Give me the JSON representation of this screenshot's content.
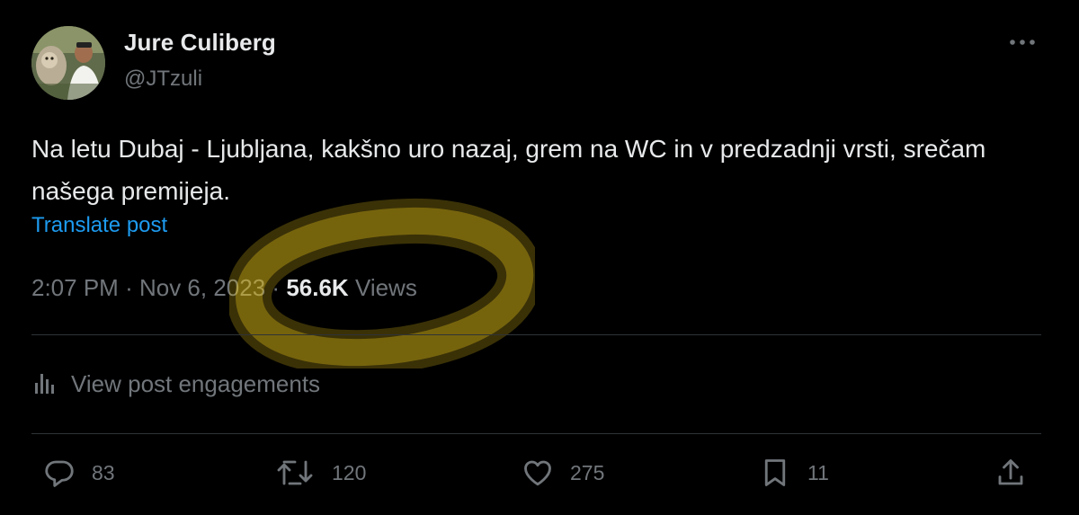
{
  "author": {
    "name": "Jure Culiberg",
    "handle": "@JTzuli"
  },
  "post": {
    "text": "Na letu Dubaj - Ljubljana, kakšno uro nazaj, grem na WC in v predzadnji vrsti, srečam našega premijeja.",
    "translate_label": "Translate post",
    "time": "2:07 PM",
    "separator": "·",
    "date": "Nov 6, 2023",
    "views_count": "56.6K",
    "views_label": "Views"
  },
  "engagements": {
    "label": "View post engagements"
  },
  "actions": {
    "replies": "83",
    "reposts": "120",
    "likes": "275",
    "bookmarks": "11"
  },
  "icons": {
    "more": "more-horizontal-icon",
    "analytics": "analytics-icon",
    "reply": "reply-icon",
    "repost": "repost-icon",
    "like": "heart-icon",
    "bookmark": "bookmark-icon",
    "share": "share-icon"
  },
  "colors": {
    "background": "#000000",
    "text_primary": "#e7e9ea",
    "text_secondary": "#71767b",
    "link": "#1d9bf0",
    "divider": "#2f3336",
    "highlight": "#e8c21a"
  }
}
